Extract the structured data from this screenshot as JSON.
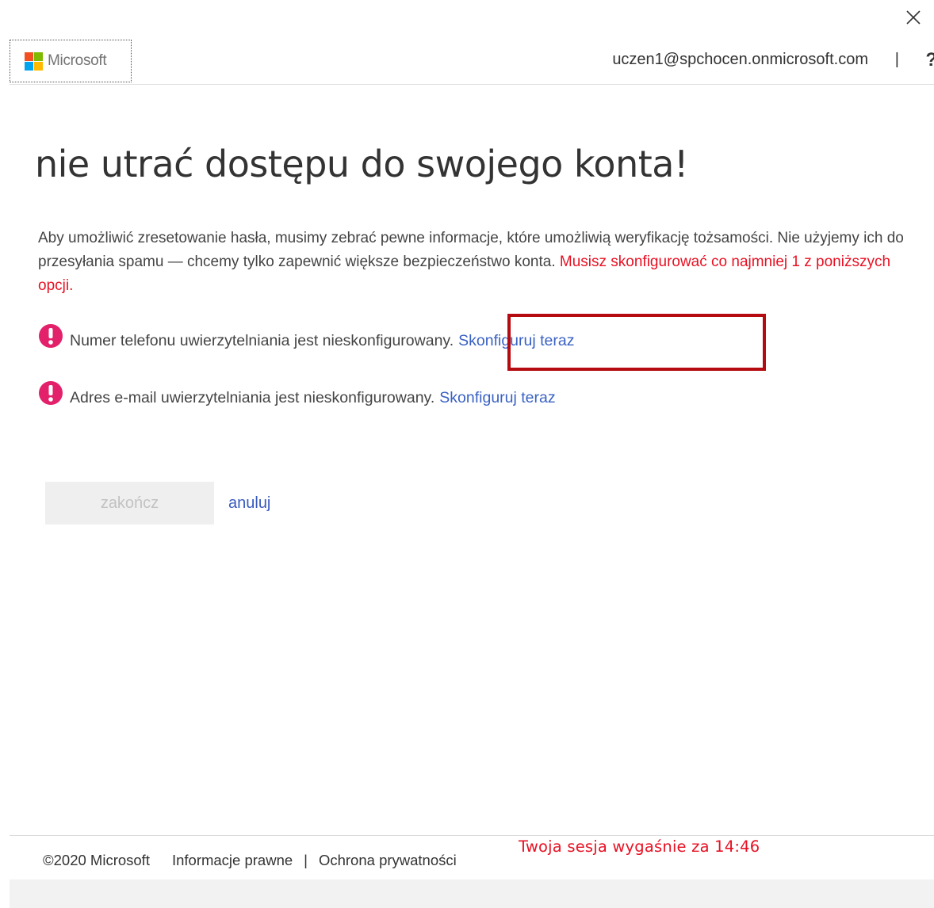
{
  "header": {
    "logo_text": "Microsoft",
    "user_email": "uczen1@spchocen.onmicrosoft.com",
    "divider": "|",
    "help_label": "?"
  },
  "main": {
    "title": "nie utrać dostępu do swojego konta!",
    "intro": "Aby umożliwić zresetowanie hasła, musimy zebrać pewne informacje, które umożliwią weryfikację tożsamości. Nie użyjemy ich do przesyłania spamu — chcemy tylko zapewnić większe bezpieczeństwo konta.",
    "intro_warning": "Musisz skonfigurować co najmniej 1 z poniższych opcji.",
    "options": [
      {
        "text": "Numer telefonu uwierzytelniania jest nieskonfigurowany.",
        "link": "Skonfiguruj teraz"
      },
      {
        "text": "Adres e-mail uwierzytelniania jest nieskonfigurowany.",
        "link": "Skonfiguruj teraz"
      }
    ],
    "finish_label": "zakończ",
    "cancel_label": "anuluj"
  },
  "footer": {
    "copyright": "©2020 Microsoft",
    "legal": "Informacje prawne",
    "separator": "|",
    "privacy": "Ochrona prywatności",
    "session_warning": "Twoja sesja wygaśnie za 14:46"
  },
  "colors": {
    "link": "#3a62c4",
    "warning": "#e81123",
    "alert_icon": "#e3216b",
    "highlight": "#b40a10",
    "ms_red": "#f25022",
    "ms_green": "#7fba00",
    "ms_blue": "#00a4ef",
    "ms_yellow": "#ffb900"
  },
  "icons": {
    "close": "close-icon",
    "alert": "exclamation-circle-icon",
    "help": "question-mark-icon"
  }
}
